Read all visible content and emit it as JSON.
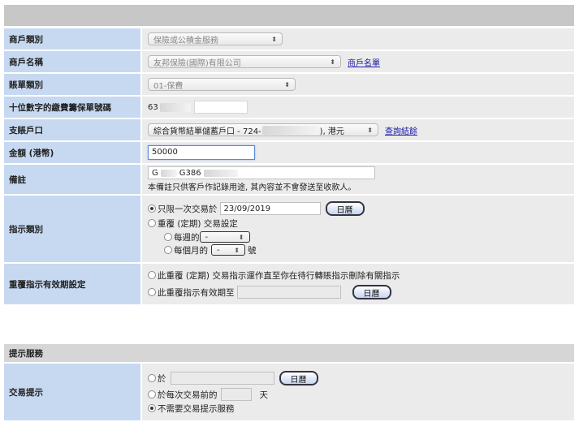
{
  "form": {
    "merchant_type": {
      "label": "商戶類別",
      "value": "保險或公積金服務"
    },
    "merchant_name": {
      "label": "商戶名稱",
      "value": "友邦保險(國際)有限公司",
      "link": "商戶名單"
    },
    "bill_type": {
      "label": "賬單類別",
      "value": "01-保費"
    },
    "policy_no": {
      "label": "十位數字的繳費籌保單號碼",
      "value": "63"
    },
    "debit_account": {
      "label": "支賬戶口",
      "value_prefix": "綜合貨幣結單儲蓄戶口 - 724-",
      "value_suffix": "), 港元",
      "link": "查詢結餘"
    },
    "amount": {
      "label": "金額 (港幣)",
      "value": "50000"
    },
    "remarks": {
      "label": "備註",
      "value_a": "G",
      "value_b": "G386",
      "note": "本備註只供客戶作記錄用途, 其內容並不會發送至收款人。"
    },
    "instruction_type": {
      "label": "指示類別",
      "once_label": "只限一次交易於",
      "once_date": "23/09/2019",
      "calendar_btn": "日曆",
      "recurring_label": "重覆 (定期) 交易設定",
      "weekly_label": "每週的",
      "weekly_value": "-",
      "monthly_label": "每個月的",
      "monthly_value": "-",
      "monthly_suffix": "號"
    },
    "validity": {
      "label": "重覆指示有效期設定",
      "option1": "此重覆 (定期) 交易指示運作直至你在待行轉賬指示刪除有關指示",
      "option2": "此重覆指示有效期至",
      "calendar_btn": "日曆"
    }
  },
  "reminder": {
    "section_title": "提示服務",
    "label": "交易提示",
    "option1": "於",
    "calendar_btn": "日曆",
    "option2_prefix": "於每次交易前的",
    "option2_suffix": "天",
    "option3": "不需要交易提示服務"
  }
}
